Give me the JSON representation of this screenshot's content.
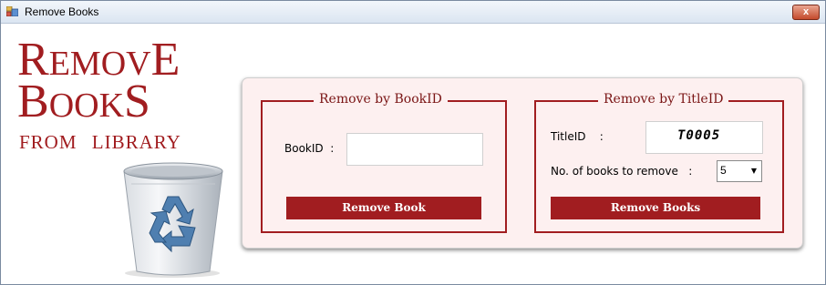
{
  "window": {
    "title": "Remove Books",
    "close_glyph": "x"
  },
  "logo": {
    "line1_cap": "R",
    "line1_rest": "EMOV",
    "line1_end": "E",
    "line2_cap": "B",
    "line2_rest": "OOK",
    "line2_end": "S",
    "line3": "FROM LIBRARY"
  },
  "by_book_id": {
    "legend": "Remove by BookID",
    "label": "BookID  :",
    "value": "",
    "button": "Remove Book"
  },
  "by_title_id": {
    "legend": "Remove by TitleID",
    "title_label": "TitleID    :",
    "title_value": "T0005",
    "count_label": "No. of books to remove   :",
    "count_value": "5",
    "button": "Remove Books"
  },
  "icons": [
    "window-app-icon",
    "close-icon",
    "recycle-bin-icon",
    "dropdown-arrow-icon"
  ],
  "colors": {
    "accent": "#a11d20",
    "panel_bg": "#fdf0f0"
  }
}
